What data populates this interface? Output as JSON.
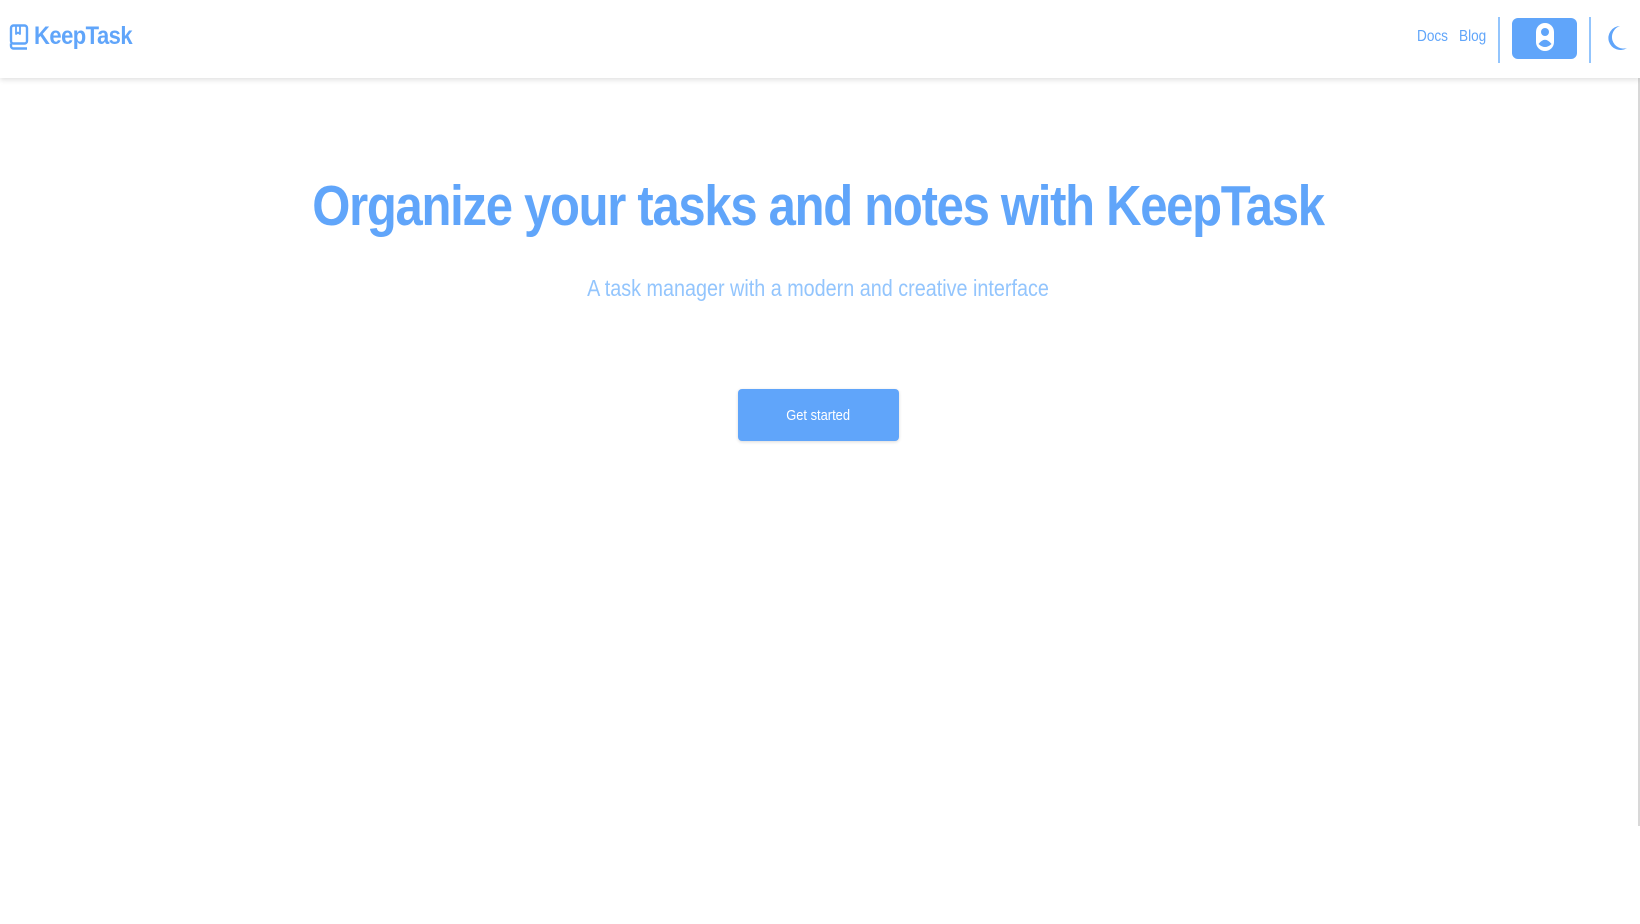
{
  "navbar": {
    "brand": {
      "name": "KeepTask",
      "icon": "keeptask-logo-icon"
    },
    "links": [
      {
        "label": "Docs"
      },
      {
        "label": "Blog"
      }
    ],
    "user_button_icon": "user-icon",
    "theme_toggle_icon": "moon-icon"
  },
  "hero": {
    "title": "Organize your tasks and notes with KeepTask",
    "subtitle": "A task manager with a modern and creative interface",
    "cta_label": "Get started"
  },
  "colors": {
    "primary": "#60a5fa",
    "primary_light": "#93c5fd",
    "background": "#ffffff",
    "button_text": "#ffffff"
  }
}
